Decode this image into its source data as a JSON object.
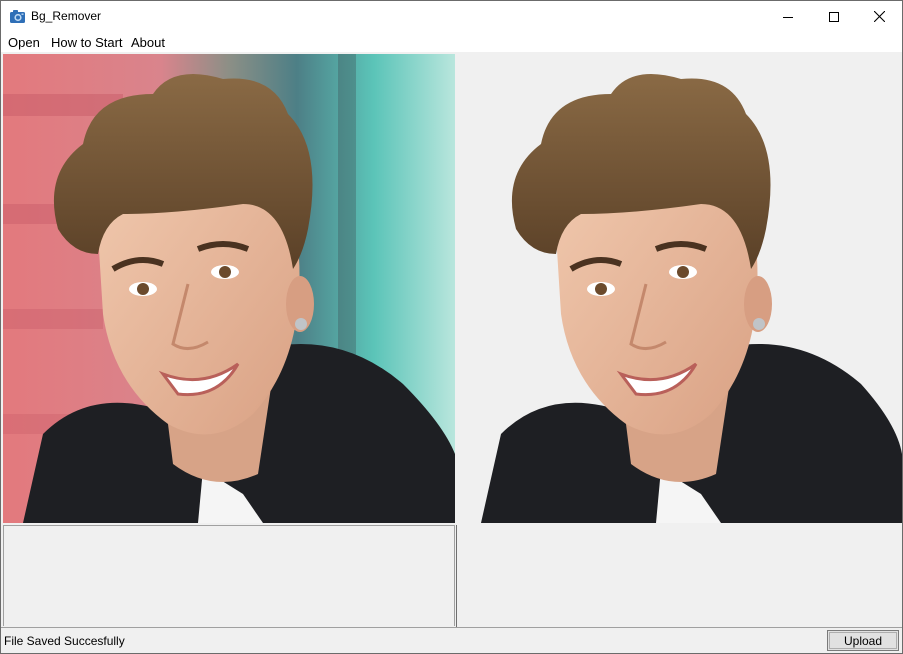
{
  "window": {
    "title": "Bg_Remover",
    "icon": "camera-icon",
    "controls": [
      "minimize-icon",
      "maximize-icon",
      "close-icon"
    ]
  },
  "menu": {
    "items": [
      {
        "label": "Open"
      },
      {
        "label": "How to Start"
      },
      {
        "label": "About"
      }
    ]
  },
  "images": {
    "original": {
      "background": "blurred-colorful"
    },
    "result": {
      "background": "removed"
    }
  },
  "status": {
    "text": "File Saved Succesfully"
  },
  "actions": {
    "upload_label": "Upload"
  },
  "colors": {
    "window_bg": "#f0f0f0",
    "titlebar_bg": "#ffffff",
    "button_bg": "#e1e1e1"
  }
}
